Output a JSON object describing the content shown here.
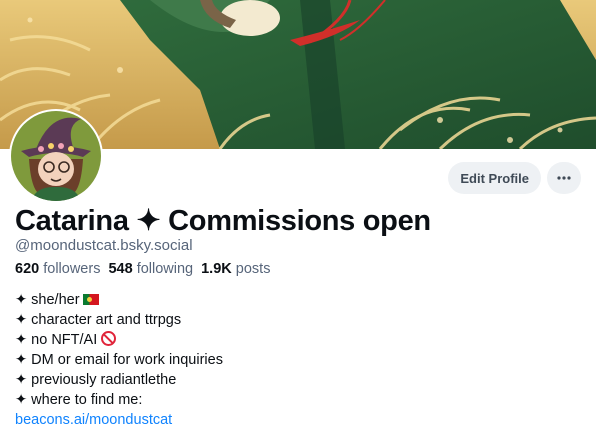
{
  "profile": {
    "display_name": "Catarina ✦ Commissions open",
    "handle": "@moondustcat.bsky.social"
  },
  "actions": {
    "edit_label": "Edit Profile",
    "more_icon": "ellipsis-icon"
  },
  "stats": {
    "followers_count": "620",
    "followers_label": "followers",
    "following_count": "548",
    "following_label": "following",
    "posts_count": "1.9K",
    "posts_label": "posts"
  },
  "bio": {
    "line1": "✦ she/her",
    "line1_icon": "portugal-flag-icon",
    "line2": "✦ character art and ttrpgs",
    "line3": "✦ no NFT/AI",
    "line3_icon": "prohibited-icon",
    "line4": "✦ DM or email for work inquiries",
    "line5": "✦ previously radiantlethe",
    "line6": "✦ where to find me:",
    "link": "beacons.ai/moondustcat"
  },
  "colors": {
    "accent_link": "#1083fe",
    "muted_text": "#57657a",
    "button_bg": "#eef1f4"
  }
}
